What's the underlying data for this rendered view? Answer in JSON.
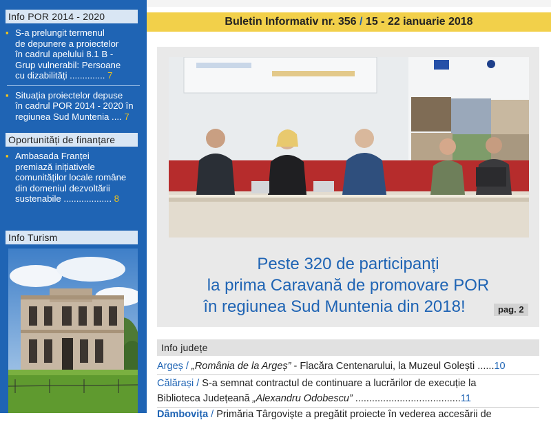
{
  "sidebar": {
    "info_por": {
      "heading": "Info POR 2014 - 2020",
      "items": [
        {
          "lines": [
            "S-a prelungit termenul",
            "de depunere a proiectelor",
            "în cadrul apelului 8.1 B -",
            "Grup vulnerabil: Persoane",
            "cu dizabilități .............."
          ],
          "page": "7"
        },
        {
          "lines": [
            "Situația proiectelor depuse",
            "în cadrul POR 2014 - 2020 în",
            "regiunea Sud Muntenia ...."
          ],
          "page": "7"
        }
      ]
    },
    "oportunitati": {
      "heading": "Oportunități de finanțare",
      "items": [
        {
          "lines": [
            "Ambasada Franței",
            "premiază inițiativele",
            "comunităților locale române",
            "din domeniul dezvoltării",
            "sustenabile ..................."
          ],
          "page": "8"
        }
      ]
    },
    "info_turism": {
      "heading": "Info Turism"
    }
  },
  "bulletin": {
    "title": "Buletin Informativ nr. 356",
    "slash": "/",
    "dates": "15 - 22 ianuarie 2018"
  },
  "main_story": {
    "headline_lines": [
      "Peste 320 de participanți",
      "la prima Caravană de promovare POR",
      "în regiunea Sud Muntenia din 2018!"
    ],
    "page_ref": "pag. 2"
  },
  "info_judete": {
    "heading": "Info județe",
    "items": [
      {
        "county": "Argeș",
        "slash": " / ",
        "line1_italic": "„România de la Argeș”",
        "line1_rest": " - Flacăra Centenarului, la Muzeul Golești ......",
        "page": "10"
      },
      {
        "county": "Călărași",
        "slash": " / ",
        "line1_rest": "S-a semnat contractul de continuare a lucrărilor de execuție la",
        "line2_pre": "Biblioteca Județeană ",
        "line2_italic": "„Alexandru Odobescu”",
        "line2_dots": " ......................................",
        "page": "11"
      },
      {
        "county": "Dâmbovița",
        "slash": " / ",
        "line1_rest": "Primăria Târgoviște a pregătit proiecte în vederea accesării de"
      }
    ]
  },
  "colors": {
    "sidebar_blue": "#1f64b4",
    "accent_yellow": "#f5c518",
    "bulletin_bar": "#f2d04a",
    "headline_blue": "#1f64b4"
  }
}
